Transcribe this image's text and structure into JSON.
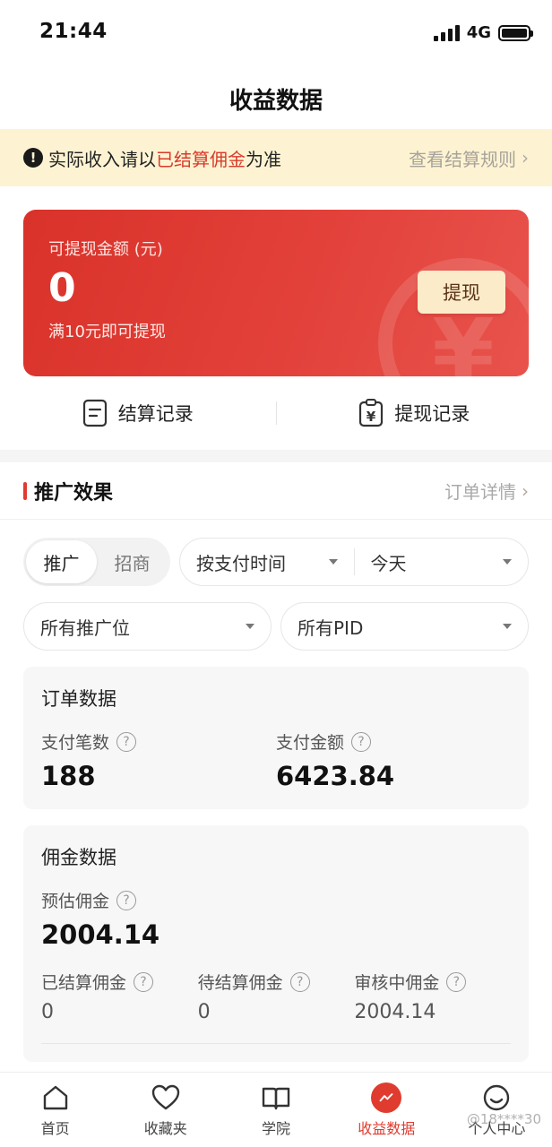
{
  "status_bar": {
    "time": "21:44",
    "network": "4G"
  },
  "nav": {
    "title": "收益数据"
  },
  "notice": {
    "text_before": "实际收入请以",
    "text_highlight": "已结算佣金",
    "text_after": "为准",
    "link": "查看结算规则"
  },
  "balance_card": {
    "label": "可提现金额 (元)",
    "amount": "0",
    "hint": "满10元即可提现",
    "withdraw_button": "提现",
    "watermark_symbol": "¥"
  },
  "records": {
    "settlement": "结算记录",
    "withdraw": "提现记录"
  },
  "promotion": {
    "title": "推广效果",
    "link": "订单详情"
  },
  "filters": {
    "segment": [
      "推广",
      "招商"
    ],
    "time_type": "按支付时间",
    "date_range": "今天",
    "position": "所有推广位",
    "pid": "所有PID"
  },
  "order_data": {
    "title": "订单数据",
    "pay_count_label": "支付笔数",
    "pay_count": "188",
    "pay_amount_label": "支付金额",
    "pay_amount": "6423.84"
  },
  "commission_data": {
    "title": "佣金数据",
    "estimated_label": "预估佣金",
    "estimated": "2004.14",
    "settled_label": "已结算佣金",
    "settled": "0",
    "pending_label": "待结算佣金",
    "pending": "0",
    "reviewing_label": "审核中佣金",
    "reviewing": "2004.14"
  },
  "tabbar": {
    "home": "首页",
    "favorites": "收藏夹",
    "academy": "学院",
    "earnings": "收益数据",
    "profile": "个人中心"
  },
  "watermark": "@18****30",
  "colors": {
    "accent": "#e03b2f",
    "notice_bg": "#fdf3d2",
    "button_bg": "#fcebc9"
  }
}
